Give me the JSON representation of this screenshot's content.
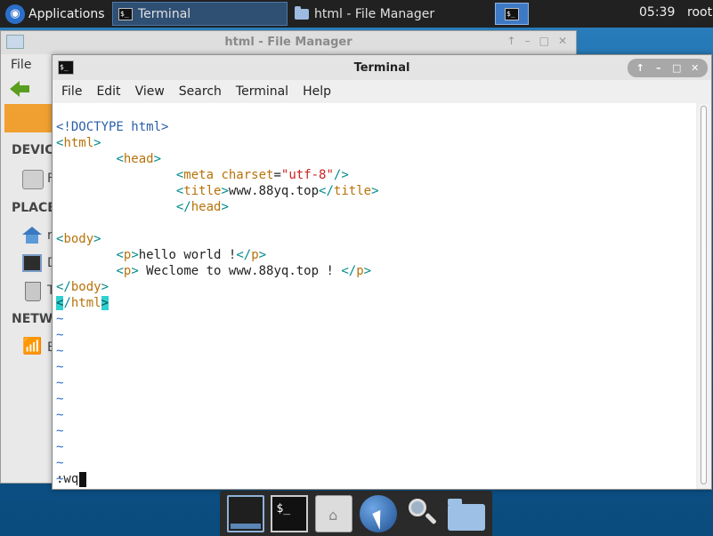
{
  "top_panel": {
    "applications_label": "Applications",
    "tasks": [
      {
        "label": "Terminal",
        "active": true
      },
      {
        "label": "html - File Manager",
        "active": false
      }
    ],
    "clock": "05:39",
    "user": "root"
  },
  "file_manager": {
    "title": "html - File Manager",
    "menu_file": "File",
    "sidebar": {
      "devices_heading": "DEVIC",
      "places_heading": "PLACE",
      "network_heading": "NETW",
      "device_letter": "F",
      "place_letters": [
        "r",
        "D",
        "T"
      ],
      "network_letter": "B"
    }
  },
  "terminal": {
    "title": "Terminal",
    "menu": [
      "File",
      "Edit",
      "View",
      "Search",
      "Terminal",
      "Help"
    ],
    "code": {
      "doctype": "<!DOCTYPE html>",
      "html_open": "html",
      "head_open": "head",
      "meta_tag": "meta",
      "meta_attr": "charset",
      "meta_value": "\"utf-8\"",
      "title_tag": "title",
      "title_text": "www.88yq.top",
      "head_close": "head",
      "body_open": "body",
      "p_tag": "p",
      "p1_text": "hello world !",
      "p2_text": " Weclome to www.88yq.top ! ",
      "body_close": "body",
      "html_close": "html"
    },
    "tilde": "~",
    "tilde_count": 11,
    "command_line": ":wq"
  },
  "colors": {
    "tag": "#008a8a",
    "tag_name": "#b8720a",
    "string": "#cc1f1f",
    "doctype": "#2a5ea8",
    "cursor_match": "#2ed0d0"
  }
}
